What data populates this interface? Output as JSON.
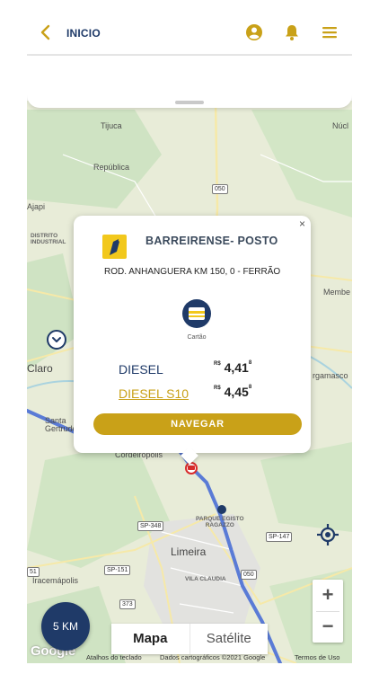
{
  "header": {
    "title": "INICIO",
    "colors": {
      "accent": "#c9a118",
      "brand": "#1f3a68"
    }
  },
  "map": {
    "labels": {
      "tijuca": "Tijuca",
      "republica": "República",
      "nucleo": "Núcl",
      "ajapi": "Ajapi",
      "distrito_line1": "DISTRITO",
      "distrito_line2": "INDUSTRIAL",
      "membe": "Membe",
      "claro": "Claro",
      "bergamasco": "rgamasco",
      "santa_line1": "Santa",
      "santa_line2": "Gertrude",
      "cordeiropolis": "Cordeirópolis",
      "parque_line1": "PARQUE EGISTO",
      "parque_line2": "RAGAZZO",
      "limeira": "Limeira",
      "vila_claudia": "VILA CLAUDIA",
      "iracemapolis": "Iracemápolis"
    },
    "shields": {
      "r050a": "050",
      "sp348": "SP-348",
      "sp147": "SP-147",
      "sp151": "SP-151",
      "s51": "51",
      "r373": "373",
      "r050b": "050"
    },
    "radius_label": "5 KM",
    "map_type": {
      "map": "Mapa",
      "satellite": "Satélite"
    },
    "attribution": {
      "google": "Google",
      "shortcuts": "Atalhos do teclado",
      "data": "Dados cartográficos ©2021 Google",
      "terms": "Termos de Uso"
    },
    "zoom": {
      "in": "+",
      "out": "−"
    }
  },
  "station": {
    "name": "BARREIRENSE- POSTO",
    "address": "ROD. ANHANGUERA KM 150, 0 - FERRÃO",
    "payment_label": "Cartão",
    "close_label": "×",
    "fuels": [
      {
        "name": "DIESEL",
        "currency": "R$",
        "price": "4,41",
        "fraction": "8"
      },
      {
        "name": "DIESEL S10",
        "currency": "R$",
        "price": "4,45",
        "fraction": "8"
      }
    ],
    "navigate_label": "NAVEGAR"
  },
  "icons": {
    "back": "chevron-left-icon",
    "profile": "user-circle-icon",
    "notifications": "bell-icon",
    "menu": "hamburger-icon",
    "locate": "crosshair-icon",
    "payment": "credit-card-icon",
    "station_logo": "ipiranga-logo"
  }
}
